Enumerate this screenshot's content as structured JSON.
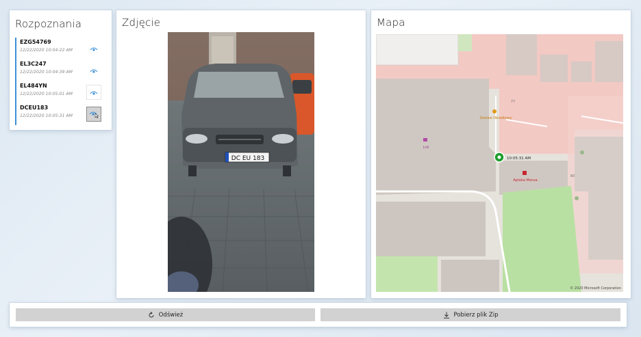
{
  "recognitions": {
    "title": "Rozpoznania",
    "items": [
      {
        "plate": "EZG54769",
        "time": "12/22/2020 10:04:22 AM",
        "icon": "eye-icon",
        "state": "normal"
      },
      {
        "plate": "EL3C247",
        "time": "12/22/2020 10:04:39 AM",
        "icon": "eye-icon",
        "state": "normal"
      },
      {
        "plate": "EL484YN",
        "time": "12/22/2020 10:05:01 AM",
        "icon": "eye-icon",
        "state": "hover"
      },
      {
        "plate": "DCEU183",
        "time": "12/22/2020 10:05:31 AM",
        "icon": "eye-icon",
        "state": "selected"
      }
    ],
    "accent_color": "#3b8fd6"
  },
  "photo": {
    "title": "Zdjęcie",
    "license_plate_text": "DC EU 183"
  },
  "map": {
    "title": "Mapa",
    "marker_time": "10:05:31 AM",
    "poi_labels": [
      "Zestaw Obiadkowy",
      "Lidl",
      "Apteka Mensa",
      "77",
      "80"
    ],
    "copyright": "© 2020 Microsoft Corporation",
    "marker_color": "#1e9e2e"
  },
  "actions": {
    "refresh_label": "Odśwież",
    "download_label": "Pobierz plik Zip"
  }
}
